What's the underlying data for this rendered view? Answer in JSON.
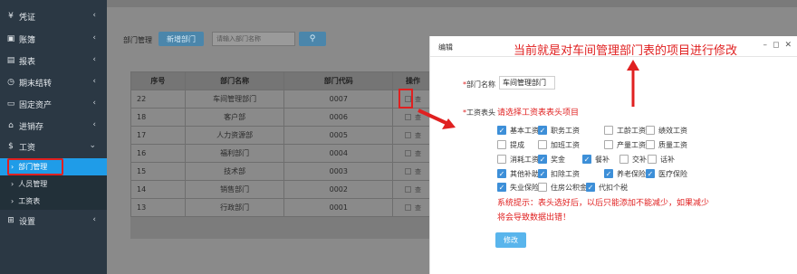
{
  "sidebar": {
    "items": [
      {
        "label": "凭证",
        "icon": "money-icon"
      },
      {
        "label": "账簿",
        "icon": "book-icon"
      },
      {
        "label": "报表",
        "icon": "report-icon"
      },
      {
        "label": "期末结转",
        "icon": "clock-icon"
      },
      {
        "label": "固定资产",
        "icon": "monitor-icon"
      },
      {
        "label": "进销存",
        "icon": "inventory-icon"
      },
      {
        "label": "工资",
        "icon": "dollar-icon"
      },
      {
        "label": "设置",
        "icon": "grid-icon"
      }
    ],
    "sub_items": [
      {
        "label": "部门管理",
        "active": true
      },
      {
        "label": "人员管理",
        "active": false
      },
      {
        "label": "工资表",
        "active": false
      }
    ]
  },
  "toolbar": {
    "label": "部门管理",
    "new_label": "新增部门",
    "search_placeholder": "请输入部门名称"
  },
  "table": {
    "headers": [
      "序号",
      "部门名称",
      "部门代码",
      "操作"
    ],
    "rows": [
      {
        "no": "22",
        "name": "车间管理部门",
        "code": "0007"
      },
      {
        "no": "18",
        "name": "客户部",
        "code": "0006"
      },
      {
        "no": "17",
        "name": "人力资源部",
        "code": "0005"
      },
      {
        "no": "16",
        "name": "福利部门",
        "code": "0004"
      },
      {
        "no": "15",
        "name": "技术部",
        "code": "0003"
      },
      {
        "no": "14",
        "name": "销售部门",
        "code": "0002"
      },
      {
        "no": "13",
        "name": "行政部门",
        "code": "0001"
      }
    ],
    "row_action_text": "查"
  },
  "modal": {
    "title": "编辑",
    "dept_label": "部门名称",
    "dept_value": "车间管理部门",
    "header_label": "工资表头",
    "checkboxes": [
      {
        "label": "基本工资",
        "checked": true
      },
      {
        "label": "职务工资",
        "checked": true
      },
      {
        "label": "工龄工资",
        "checked": false
      },
      {
        "label": "绩效工资",
        "checked": false
      },
      {
        "label": "提成",
        "checked": false
      },
      {
        "label": "加班工资",
        "checked": false
      },
      {
        "label": "产量工资",
        "checked": false
      },
      {
        "label": "质量工资",
        "checked": false
      },
      {
        "label": "消耗工资",
        "checked": false
      },
      {
        "label": "奖金",
        "checked": true
      },
      {
        "label": "餐补",
        "checked": true
      },
      {
        "label": "交补",
        "checked": false
      },
      {
        "label": "话补",
        "checked": false
      },
      {
        "label": "其他补助",
        "checked": true
      },
      {
        "label": "扣除工资",
        "checked": true
      },
      {
        "label": "养老保险",
        "checked": true
      },
      {
        "label": "医疗保险",
        "checked": true
      },
      {
        "label": "失业保险",
        "checked": true
      },
      {
        "label": "住房公积金",
        "checked": false
      },
      {
        "label": "代扣个税",
        "checked": true
      }
    ],
    "hint": "请选择工资表表头项目",
    "sys_tip": "系统提示：表头选好后，以后只能添加不能减少，如果减少将会导致数据出错！",
    "edit_button": "修改"
  },
  "annotation": {
    "top_text": "当前就是对车间管理部门表的项目进行修改"
  },
  "colors": {
    "sidebar_bg": "#2b3844",
    "active": "#1f9ce8",
    "annotation_red": "#e02020",
    "checkbox_blue": "#3d8fd8"
  }
}
